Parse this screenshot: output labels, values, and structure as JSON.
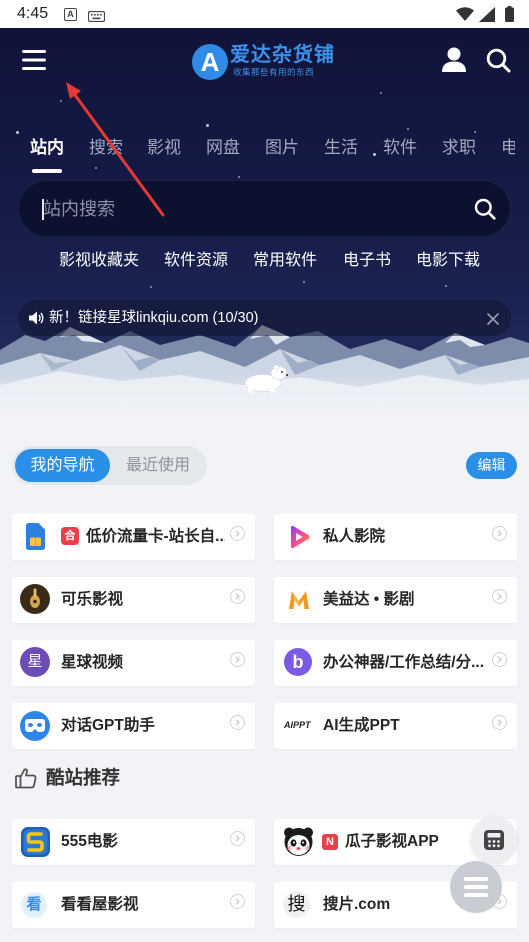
{
  "status_bar": {
    "time": "4:45",
    "app_icon_letter": "A",
    "left_icons": [
      "app-a-icon",
      "keyboard-icon"
    ],
    "right_icons": [
      "wifi-icon",
      "signal-icon",
      "battery-icon"
    ]
  },
  "header": {
    "menu_icon": "hamburger-menu-icon",
    "logo": {
      "letter": "A",
      "name": "爱达杂货铺",
      "slogan": "收集那些有用的东西"
    },
    "user_icon": "user-icon",
    "search_icon": "search-icon"
  },
  "tabs": [
    {
      "label": "站内",
      "active": true
    },
    {
      "label": "搜索",
      "active": false
    },
    {
      "label": "影视",
      "active": false
    },
    {
      "label": "网盘",
      "active": false
    },
    {
      "label": "图片",
      "active": false
    },
    {
      "label": "生活",
      "active": false
    },
    {
      "label": "软件",
      "active": false
    },
    {
      "label": "求职",
      "active": false
    },
    {
      "label": "电",
      "active": false
    }
  ],
  "search": {
    "placeholder": "站内搜索",
    "value": "",
    "icon": "search-icon"
  },
  "quick_links": [
    {
      "label": "影视收藏夹"
    },
    {
      "label": "软件资源"
    },
    {
      "label": "常用软件"
    },
    {
      "label": "电子书"
    },
    {
      "label": "电影下载"
    }
  ],
  "notice": {
    "icon": "speaker-icon",
    "text": "新！链接星球linkqiu.com (10/30)",
    "close_icon": "close-icon"
  },
  "nav_toggle": {
    "options": [
      "我的导航",
      "最近使用"
    ],
    "active_index": 0
  },
  "edit_button": {
    "label": "编辑"
  },
  "my_nav": [
    {
      "title": "低价流量卡-站长自...",
      "icon": "sim-card-icon",
      "badge": "合"
    },
    {
      "title": "私人影院",
      "icon": "play-icon"
    },
    {
      "title": "可乐影视",
      "icon": "cola-logo-icon"
    },
    {
      "title": "美益达 • 影剧",
      "icon": "m-logo-icon"
    },
    {
      "title": "星球视频",
      "icon": "star-logo-icon",
      "icon_text": "星"
    },
    {
      "title": "办公神器/工作总结/分...",
      "icon": "b-logo-icon",
      "icon_text": "b"
    },
    {
      "title": "对话GPT助手",
      "icon": "gpt-mask-icon"
    },
    {
      "title": "AI生成PPT",
      "icon": "aippt-logo-icon",
      "icon_text": "AIPPT"
    }
  ],
  "recommend_section": {
    "icon": "thumbs-up-icon",
    "title": "酷站推荐"
  },
  "recommended": [
    {
      "title": "555电影",
      "icon": "555-logo-icon"
    },
    {
      "title": "瓜子影视APP",
      "icon": "panda-icon",
      "badge": "N"
    },
    {
      "title": "看看屋影视",
      "icon": "kankan-logo-icon",
      "icon_text": "看"
    },
    {
      "title": "搜片.com",
      "icon": "soupian-logo-icon",
      "icon_text": "搜"
    }
  ],
  "floating_buttons": [
    "calculator-icon",
    "menu-icon"
  ],
  "annotation": {
    "type": "red-arrow",
    "points_to": "hamburger-menu-icon"
  },
  "colors": {
    "header_bg": "#141944",
    "accent": "#2a8fe6",
    "logo_blue": "#3b91ea",
    "page_bg": "#f1f3f6",
    "badge_red": "#e8404a",
    "annotation_red": "#e53935"
  }
}
